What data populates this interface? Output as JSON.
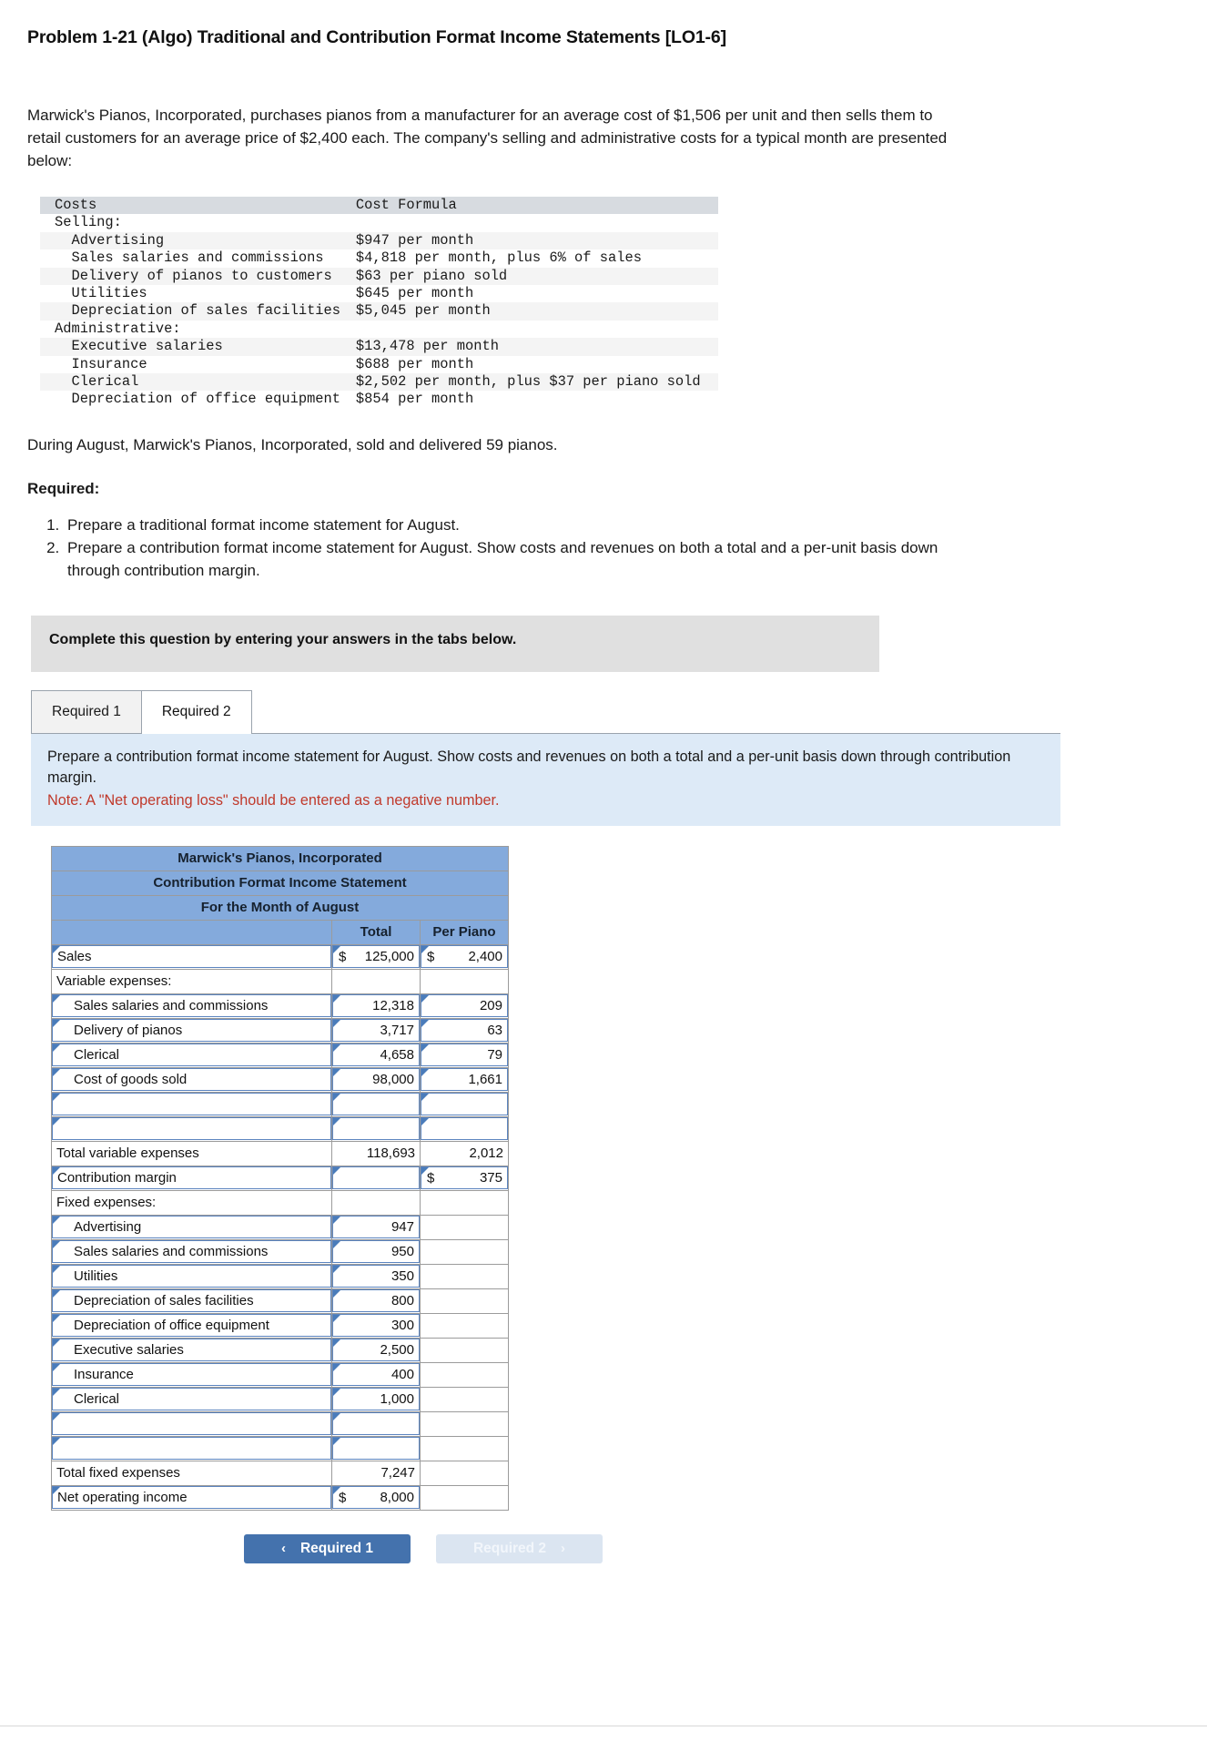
{
  "problem": {
    "title": "Problem 1-21 (Algo) Traditional and Contribution Format Income Statements [LO1-6]",
    "intro": "Marwick's Pianos, Incorporated, purchases pianos from a manufacturer for an average cost of $1,506 per unit and then sells them to retail customers for an average price of $2,400 each. The company's selling and administrative costs for a typical month are presented below:",
    "during": "During August, Marwick's Pianos, Incorporated, sold and delivered 59 pianos.",
    "required_heading": "Required:",
    "requirements": [
      "Prepare a traditional format income statement for August.",
      "Prepare a contribution format income statement for August. Show costs and revenues on both a total and a per-unit basis down through contribution margin."
    ]
  },
  "cost_table": {
    "headers": [
      "Costs",
      "Cost Formula"
    ],
    "rows": [
      {
        "indent": 1,
        "cost": "Selling:",
        "formula": ""
      },
      {
        "indent": 2,
        "cost": "Advertising",
        "formula": "$947 per month"
      },
      {
        "indent": 2,
        "cost": "Sales salaries and commissions",
        "formula": "$4,818 per month, plus 6% of sales"
      },
      {
        "indent": 2,
        "cost": "Delivery of pianos to customers",
        "formula": "$63 per piano sold"
      },
      {
        "indent": 2,
        "cost": "Utilities",
        "formula": "$645 per month"
      },
      {
        "indent": 2,
        "cost": "Depreciation of sales facilities",
        "formula": "$5,045 per month"
      },
      {
        "indent": 1,
        "cost": "Administrative:",
        "formula": ""
      },
      {
        "indent": 2,
        "cost": "Executive salaries",
        "formula": "$13,478 per month"
      },
      {
        "indent": 2,
        "cost": "Insurance",
        "formula": "$688 per month"
      },
      {
        "indent": 2,
        "cost": "Clerical",
        "formula": "$2,502 per month, plus $37 per piano sold"
      },
      {
        "indent": 2,
        "cost": "Depreciation of office equipment",
        "formula": "$854 per month"
      }
    ]
  },
  "banner": {
    "text": "Complete this question by entering your answers in the tabs below."
  },
  "tabs": [
    {
      "label": "Required 1",
      "active": false
    },
    {
      "label": "Required 2",
      "active": true
    }
  ],
  "note": {
    "instruction": "Prepare a contribution format income statement for August. Show costs and revenues on both a total and a per-unit basis down through contribution margin.",
    "warning": "Note: A \"Net operating loss\" should be entered as a negative number."
  },
  "answer_sheet": {
    "title_lines": [
      "Marwick's Pianos, Incorporated",
      "Contribution Format Income Statement",
      "For the Month of August"
    ],
    "columns": [
      "",
      "Total",
      "Per Piano"
    ],
    "rows": [
      {
        "label": "Sales",
        "indent": 0,
        "total": "125,000",
        "total_dollar": true,
        "unit": "2,400",
        "unit_dollar": true,
        "total_input": true,
        "unit_input": true
      },
      {
        "label": "Variable expenses:",
        "indent": 0,
        "total": "",
        "total_dollar": false,
        "unit": "",
        "unit_dollar": false,
        "total_input": false,
        "unit_input": false
      },
      {
        "label": "Sales salaries and commissions",
        "indent": 1,
        "total": "12,318",
        "total_dollar": false,
        "unit": "209",
        "unit_dollar": false,
        "total_input": true,
        "unit_input": true
      },
      {
        "label": "Delivery of pianos",
        "indent": 1,
        "total": "3,717",
        "total_dollar": false,
        "unit": "63",
        "unit_dollar": false,
        "total_input": true,
        "unit_input": true
      },
      {
        "label": "Clerical",
        "indent": 1,
        "total": "4,658",
        "total_dollar": false,
        "unit": "79",
        "unit_dollar": false,
        "total_input": true,
        "unit_input": true
      },
      {
        "label": "Cost of goods sold",
        "indent": 1,
        "total": "98,000",
        "total_dollar": false,
        "unit": "1,661",
        "unit_dollar": false,
        "total_input": true,
        "unit_input": true
      },
      {
        "label": "",
        "indent": 1,
        "total": "",
        "total_dollar": false,
        "unit": "",
        "unit_dollar": false,
        "total_input": true,
        "unit_input": true
      },
      {
        "label": "",
        "indent": 1,
        "total": "",
        "total_dollar": false,
        "unit": "",
        "unit_dollar": false,
        "total_input": true,
        "unit_input": true
      },
      {
        "label": "Total variable expenses",
        "indent": 0,
        "total": "118,693",
        "total_dollar": false,
        "unit": "2,012",
        "unit_dollar": false,
        "total_input": false,
        "unit_input": false
      },
      {
        "label": "Contribution margin",
        "indent": 0,
        "total": "",
        "total_dollar": false,
        "unit": "375",
        "unit_dollar": true,
        "total_input": true,
        "unit_input": true
      },
      {
        "label": "Fixed expenses:",
        "indent": 0,
        "total": "",
        "total_dollar": false,
        "unit": "",
        "unit_dollar": false,
        "total_input": false,
        "unit_input": false
      },
      {
        "label": "Advertising",
        "indent": 1,
        "total": "947",
        "total_dollar": false,
        "unit": "",
        "unit_dollar": false,
        "total_input": true,
        "unit_input": false
      },
      {
        "label": "Sales salaries and commissions",
        "indent": 1,
        "total": "950",
        "total_dollar": false,
        "unit": "",
        "unit_dollar": false,
        "total_input": true,
        "unit_input": false
      },
      {
        "label": "Utilities",
        "indent": 1,
        "total": "350",
        "total_dollar": false,
        "unit": "",
        "unit_dollar": false,
        "total_input": true,
        "unit_input": false
      },
      {
        "label": "Depreciation of sales facilities",
        "indent": 1,
        "total": "800",
        "total_dollar": false,
        "unit": "",
        "unit_dollar": false,
        "total_input": true,
        "unit_input": false
      },
      {
        "label": "Depreciation of office equipment",
        "indent": 1,
        "total": "300",
        "total_dollar": false,
        "unit": "",
        "unit_dollar": false,
        "total_input": true,
        "unit_input": false
      },
      {
        "label": "Executive salaries",
        "indent": 1,
        "total": "2,500",
        "total_dollar": false,
        "unit": "",
        "unit_dollar": false,
        "total_input": true,
        "unit_input": false
      },
      {
        "label": "Insurance",
        "indent": 1,
        "total": "400",
        "total_dollar": false,
        "unit": "",
        "unit_dollar": false,
        "total_input": true,
        "unit_input": false
      },
      {
        "label": "Clerical",
        "indent": 1,
        "total": "1,000",
        "total_dollar": false,
        "unit": "",
        "unit_dollar": false,
        "total_input": true,
        "unit_input": false
      },
      {
        "label": "",
        "indent": 1,
        "total": "",
        "total_dollar": false,
        "unit": "",
        "unit_dollar": false,
        "total_input": true,
        "unit_input": false
      },
      {
        "label": "",
        "indent": 1,
        "total": "",
        "total_dollar": false,
        "unit": "",
        "unit_dollar": false,
        "total_input": true,
        "unit_input": false
      },
      {
        "label": "Total fixed expenses",
        "indent": 0,
        "total": "7,247",
        "total_dollar": false,
        "unit": "",
        "unit_dollar": false,
        "total_input": false,
        "unit_input": false
      },
      {
        "label": "Net operating income",
        "indent": 0,
        "total": "8,000",
        "total_dollar": true,
        "unit": "",
        "unit_dollar": false,
        "total_input": true,
        "unit_input": false
      }
    ]
  },
  "nav": {
    "prev_label": "Required 1",
    "next_label": "Required 2",
    "prev_icon": "chevron-left-icon",
    "next_icon": "chevron-right-icon",
    "prev_chevron": "‹",
    "next_chevron": "›"
  },
  "colors": {
    "sheet_header_blue": "#84aadc",
    "input_border_blue": "#5b84bf",
    "note_box_blue": "#ddeaf7",
    "warning_red": "#c0392b",
    "banner_gray": "#e0e0e0",
    "prev_button_blue": "#4472ad",
    "next_button_blue": "#dbe5f1",
    "cost_header_gray": "#d7dbe0"
  }
}
